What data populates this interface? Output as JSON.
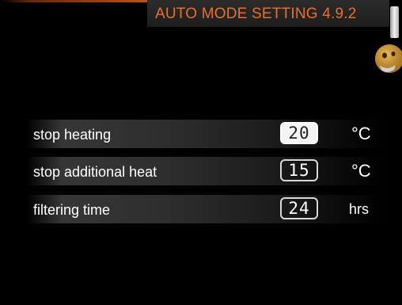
{
  "header": {
    "title": "AUTO MODE SETTING 4.9.2"
  },
  "settings": [
    {
      "label": "stop heating",
      "value": "20",
      "unit": "°C",
      "selected": true
    },
    {
      "label": "stop additional heat",
      "value": "15",
      "unit": "°C",
      "selected": false
    },
    {
      "label": "filtering time",
      "value": "24",
      "unit": "hrs",
      "selected": false
    }
  ],
  "icons": {
    "mascot": "mascot-face-icon",
    "scrollbar": "scrollbar-thumb"
  },
  "colors": {
    "background": "#000000",
    "title_text": "#e8702a",
    "title_bar": "#262626",
    "text": "#ffffff",
    "selected_value_bg": "#f4f4f4"
  }
}
